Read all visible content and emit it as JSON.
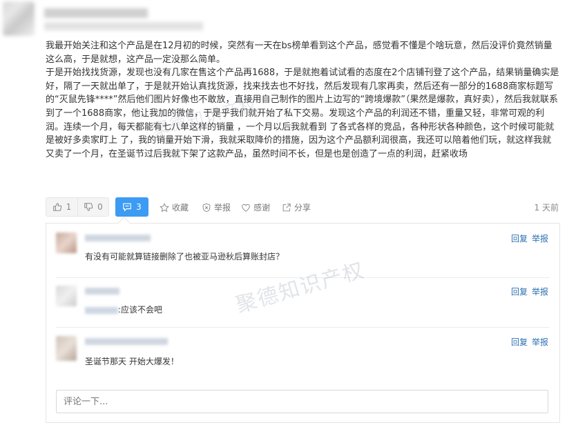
{
  "post": {
    "paragraphs": [
      "我最开始关注和这个产品是在12月初的时候，突然有一天在bs榜单看到这个产品，感觉看不懂是个啥玩意，然后没评价竟然销量这么高，于是就想，这产品一定没那么简单。",
      "于是开始找找货源，发现也没有几家在售这个产品再1688，于是就抱着试试看的态度在2个店铺刊登了这个产品，结果销量确实是好，隔了一天就出单了，于是就开始认真找货源，找来找去也不好找，然后发现有几家再卖，然后还有一部分的1688商家标题写的“灭鼠先锋****”然后他们图片好像也不敢放，直接用自己制作的图片上边写的“跨境爆款”（果然是爆款，真好卖），然后我就联系到了一个1688商家，他让我加的微信，于是乎我们就开始了私下交易。发现这个产品的利润还不错，重量又轻，非常可观的利润。连续一个月，每天都能有七八单这样的销量 ，一个月以后我就看到 了各式各样的竞品，各种形状各种颜色，这个时候可能就是被好多卖家盯上 了，我的销量开始下滑，我就采取降价的措施，因为这个产品额利润很高，我还可以陪着他们玩，就这样我就又卖了一个月，在圣诞节过后我就下架了这款产品，虽然时间不长，但是也是创造了一点的利润，赶紧收场"
    ]
  },
  "actions": {
    "upvotes": "1",
    "downvotes": "0",
    "comments": "3",
    "favorite_label": "收藏",
    "report_label": "举报",
    "thank_label": "感谢",
    "share_label": "分享",
    "time_ago": "1 天前"
  },
  "comments": [
    {
      "text": "有没有可能就算链接删除了也被亚马逊秋后算账封店？",
      "reply_label": "回复",
      "report_label": "举报"
    },
    {
      "text": ":应该不会吧",
      "reply_label": "回复",
      "report_label": "举报"
    },
    {
      "text": "圣诞节那天 开始大爆发！",
      "reply_label": "回复",
      "report_label": "举报"
    }
  ],
  "comment_input": {
    "placeholder": "评论一下..."
  },
  "watermark": "聚德知识产权",
  "colors": {
    "accent": "#3c9bf3",
    "link": "#2d6fb4"
  }
}
